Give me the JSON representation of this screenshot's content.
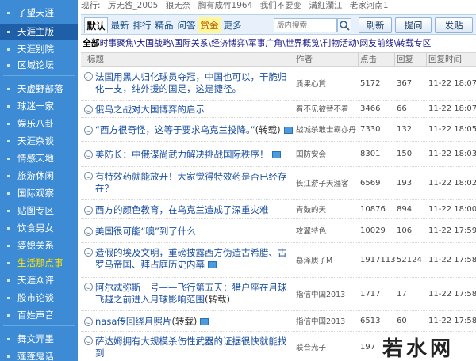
{
  "sidebar": {
    "items": [
      {
        "label": "了望天涯"
      },
      {
        "label": "天涯主版"
      },
      {
        "label": "天涯别院"
      },
      {
        "label": "区域论坛"
      },
      {
        "label": "天虚野部落"
      },
      {
        "label": "球迷一家"
      },
      {
        "label": "娱乐八卦"
      },
      {
        "label": "天涯杂谈"
      },
      {
        "label": "情感天地"
      },
      {
        "label": "旅游休闲"
      },
      {
        "label": "国际观察"
      },
      {
        "label": "贴图专区"
      },
      {
        "label": "饮食男女"
      },
      {
        "label": "婆媳关系"
      },
      {
        "label": "生活那点事"
      },
      {
        "label": "天涯众评"
      },
      {
        "label": "股市论谈"
      },
      {
        "label": "百姓声音"
      },
      {
        "label": "舞文弄墨"
      },
      {
        "label": "莲蓬鬼话"
      }
    ]
  },
  "status_line": {
    "label": "现行:",
    "users": [
      "厉无咎_2005",
      "狼无奈",
      "胸有成竹1964",
      "我们不要变",
      "溝紅瀾江",
      "老家河南1"
    ]
  },
  "tabs": [
    {
      "label": "默认"
    },
    {
      "label": "最新"
    },
    {
      "label": "排行"
    },
    {
      "label": "精品"
    },
    {
      "label": "问答"
    },
    {
      "label": "赏金"
    },
    {
      "label": "更多"
    }
  ],
  "search": {
    "placeholder": "版内搜索"
  },
  "buttons": {
    "refresh": "刷新",
    "ask": "提问",
    "post": "发贴"
  },
  "categories": {
    "all": "全部",
    "items": "时事聚焦\\大国战略\\国际关系\\经济博弈\\军事广角\\世界概览\\刊物活动\\网友前线\\转载专区"
  },
  "table": {
    "headers": {
      "title": "标题",
      "author": "作者",
      "clicks": "点击",
      "replies": "回复",
      "time": "回复时间"
    },
    "rows": [
      {
        "title": "法国用黑人归化球员夺冠，中国也可以，干脆归化一支，纯外援的国足，这是捷径。",
        "author": "质果心質",
        "clicks": "5172",
        "replies": "367",
        "time": "11-22 18:07"
      },
      {
        "title": "俄乌之战对大国博弈的启示",
        "author": "看不见被替不看",
        "clicks": "3466",
        "replies": "66",
        "time": "11-22 18:07"
      },
      {
        "title": "“西方很奇怪，这等于要求乌克兰投降。”",
        "tag": "(转载)",
        "pic": true,
        "author": "战城杀敢士霸亦丹",
        "clicks": "7330",
        "replies": "132",
        "time": "11-22 18:05"
      },
      {
        "title": "美防长：中俄谋尚武力解决挑战国际秩序！",
        "pic": true,
        "author": "国防安会",
        "clicks": "8301",
        "replies": "150",
        "time": "11-22 18:03"
      },
      {
        "title": "有特效药就能放开！大家觉得特效药是否已经存在？",
        "author": "长江游子天涯客",
        "clicks": "6569",
        "replies": "193",
        "time": "11-22 18:02"
      },
      {
        "title": "西方的颜色教育，在乌克兰造成了深重灾难",
        "author": "青鼓的天",
        "clicks": "10876",
        "replies": "894",
        "time": "11-22 18:00"
      },
      {
        "title": "美国很可能“噢”到了什么",
        "author": "攻翼特色",
        "clicks": "10029",
        "replies": "106",
        "time": "11-22 17:59"
      },
      {
        "title": "造假的埃及文明，重磅披露西方伪造古希腊、古罗马帝国、拜占庭历史内幕",
        "pic": true,
        "author": "慕泽质子M",
        "clicks": "1917113",
        "replies": "52124",
        "time": "11-22 17:58"
      },
      {
        "title": "阿尔忒弥斯一号——飞行第五天：猎户座在月球飞越之前进入月球影响范围",
        "tag": "(转载)",
        "author": "指信中国2013",
        "clicks": "1717",
        "replies": "17",
        "time": "11-22 17:58"
      },
      {
        "title": "nasa传回绕月照片",
        "tag": "(转载)",
        "pic": true,
        "author": "指信中国2013",
        "clicks": "6513",
        "replies": "60",
        "time": "11-22 17:58"
      },
      {
        "title": "萨达姆拥有大规模杀伤性武器的证据很快就能找到",
        "author": "联合光子",
        "clicks": "197",
        "replies": "",
        "time": ""
      }
    ]
  },
  "watermark": {
    "text": "若水网"
  }
}
